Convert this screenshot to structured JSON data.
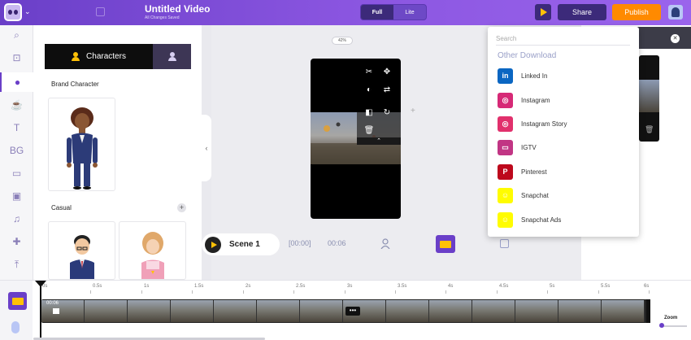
{
  "app": {
    "title": "Untitled Video",
    "save_status": "All Changes Saved",
    "mode_options": [
      "Full",
      "Lite"
    ],
    "selected_mode": "Full",
    "share_label": "Share",
    "publish_label": "Publish"
  },
  "rail": {
    "items": [
      {
        "icon": "search-icon",
        "glyph": "⌕"
      },
      {
        "icon": "scene-icon",
        "glyph": "⊡"
      },
      {
        "icon": "character-icon",
        "glyph": "●",
        "active": true
      },
      {
        "icon": "props-icon",
        "glyph": "☕"
      },
      {
        "icon": "text-icon",
        "glyph": "T"
      },
      {
        "icon": "background-icon",
        "glyph": "BG"
      },
      {
        "icon": "image-icon",
        "glyph": "▭"
      },
      {
        "icon": "video-icon",
        "glyph": "▣"
      },
      {
        "icon": "music-icon",
        "glyph": "♫"
      },
      {
        "icon": "effects-icon",
        "glyph": "✚"
      },
      {
        "icon": "upload-icon",
        "glyph": "⤒"
      }
    ]
  },
  "panel": {
    "tab_label": "Characters",
    "section_brand": "Brand Character",
    "section_casual": "Casual",
    "plus_glyph": "+",
    "collapse_glyph": "‹"
  },
  "canvas": {
    "zoom": "42%",
    "plus": "+",
    "collapse": "⌃"
  },
  "scene": {
    "label": "Scene 1",
    "start_time": "[00:00]",
    "duration": "00:06"
  },
  "right_panel": {
    "close_glyph": "✕"
  },
  "dropdown": {
    "search_placeholder": "Search",
    "heading": "Other Download",
    "items": [
      {
        "label": "Linked In",
        "icon": "linkedin-icon",
        "short": "in",
        "color": "#0a66c2"
      },
      {
        "label": "Instagram",
        "icon": "instagram-icon",
        "short": "◎",
        "color": "#d62976"
      },
      {
        "label": "Instagram Story",
        "icon": "instagram-story-icon",
        "short": "◎",
        "color": "#e1306c"
      },
      {
        "label": "IGTV",
        "icon": "igtv-icon",
        "short": "▭",
        "color": "#c13584"
      },
      {
        "label": "Pinterest",
        "icon": "pinterest-icon",
        "short": "P",
        "color": "#bd081c"
      },
      {
        "label": "Snapchat",
        "icon": "snapchat-icon",
        "short": "☺",
        "color": "#fffc00"
      },
      {
        "label": "Snapchat Ads",
        "icon": "snapchat-ads-icon",
        "short": "☺",
        "color": "#fffc00"
      }
    ]
  },
  "timeline": {
    "ticks": [
      "0s",
      "0.5s",
      "1s",
      "1.5s",
      "2s",
      "2.5s",
      "3s",
      "3.5s",
      "4s",
      "4.5s",
      "5s",
      "5.5s",
      "6s"
    ],
    "track_time": "00:06",
    "more_glyph": "•••",
    "zoom_label": "Zoom"
  }
}
